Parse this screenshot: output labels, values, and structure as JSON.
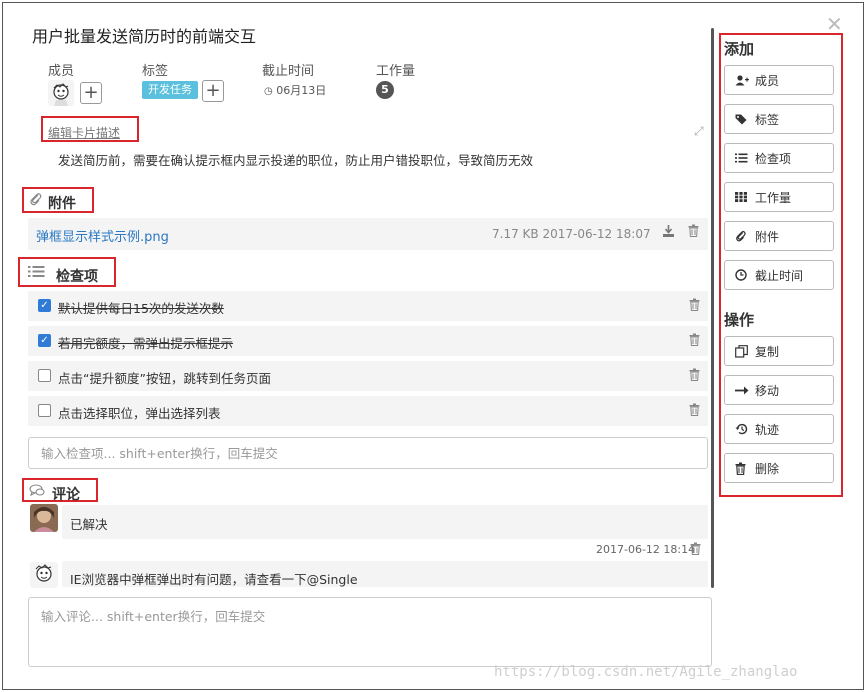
{
  "card": {
    "title": "用户批量发送简历时的前端交互",
    "close_glyph": "✕"
  },
  "meta": {
    "members_label": "成员",
    "tags_label": "标签",
    "due_label": "截止时间",
    "workload_label": "工作量",
    "tag_value": "开发任务",
    "due_value": "06月13日",
    "workload_value": "5",
    "plus_glyph": "+"
  },
  "description": {
    "edit_link": "编辑卡片描述",
    "text": "发送简历前，需要在确认提示框内显示投递的职位，防止用户错投职位，导致简历无效"
  },
  "attachments": {
    "heading": "附件",
    "items": [
      {
        "name": "弹框显示样式示例.png",
        "meta": "7.17 KB  2017-06-12 18:07"
      }
    ]
  },
  "checklist": {
    "heading": "检查项",
    "items": [
      {
        "text": "默认提供每日15次的发送次数",
        "checked": true
      },
      {
        "text": "若用完额度，需弹出提示框提示",
        "checked": true
      },
      {
        "text": "点击“提升额度”按钮，跳转到任务页面",
        "checked": false
      },
      {
        "text": "点击选择职位，弹出选择列表",
        "checked": false
      }
    ],
    "input_placeholder": "输入检查项... shift+enter换行，回车提交"
  },
  "comments": {
    "heading": "评论",
    "items": [
      {
        "text": "已解决",
        "time": "2017-06-12 18:14"
      },
      {
        "text": "IE浏览器中弹框弹出时有问题，请查看一下@Single"
      }
    ],
    "input_placeholder": "输入评论... shift+enter换行，回车提交"
  },
  "sidebar": {
    "add_heading": "添加",
    "add_buttons": [
      {
        "label": "成员",
        "icon": "add-user-icon"
      },
      {
        "label": "标签",
        "icon": "tag-icon"
      },
      {
        "label": "检查项",
        "icon": "list-icon"
      },
      {
        "label": "工作量",
        "icon": "grid-icon"
      },
      {
        "label": "附件",
        "icon": "paperclip-icon"
      },
      {
        "label": "截止时间",
        "icon": "clock-icon"
      }
    ],
    "ops_heading": "操作",
    "op_buttons": [
      {
        "label": "复制",
        "icon": "copy-icon"
      },
      {
        "label": "移动",
        "icon": "arrow-right-icon"
      },
      {
        "label": "轨迹",
        "icon": "history-icon"
      },
      {
        "label": "删除",
        "icon": "trash-icon"
      }
    ]
  },
  "watermark": "https://blog.csdn.net/Agile_zhanglao",
  "colors": {
    "accent": "#2f7bd6",
    "link": "#2a78c2",
    "tag": "#5bc0de",
    "annotation_red": "#d9262c"
  }
}
